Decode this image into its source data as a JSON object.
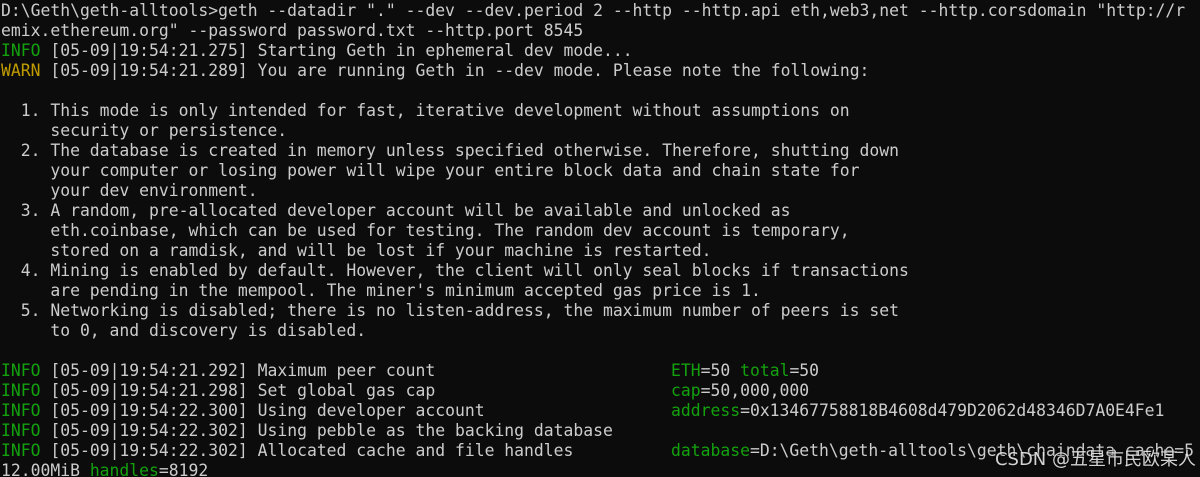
{
  "terminal": {
    "colors": {
      "background": "#0c0c0c",
      "text": "#cccccc",
      "info": "#13a10e",
      "warn": "#c19c00"
    },
    "command": {
      "line1": "D:\\Geth\\geth-alltools>geth --datadir \".\" --dev --dev.period 2 --http --http.api eth,web3,net --http.corsdomain \"http://r",
      "line2": "emix.ethereum.org\" --password password.txt --http.port 8545"
    },
    "log_head": [
      {
        "level": "INFO",
        "ts": "[05-09|19:54:21.275]",
        "msg": "Starting Geth in ephemeral dev mode..."
      },
      {
        "level": "WARN",
        "ts": "[05-09|19:54:21.289]",
        "msg": "You are running Geth in --dev mode. Please note the following:"
      }
    ],
    "notes": [
      "  1. This mode is only intended for fast, iterative development without assumptions on",
      "     security or persistence.",
      "  2. The database is created in memory unless specified otherwise. Therefore, shutting down",
      "     your computer or losing power will wipe your entire block data and chain state for",
      "     your dev environment.",
      "  3. A random, pre-allocated developer account will be available and unlocked as",
      "     eth.coinbase, which can be used for testing. The random dev account is temporary,",
      "     stored on a ramdisk, and will be lost if your machine is restarted.",
      "  4. Mining is enabled by default. However, the client will only seal blocks if transactions",
      "     are pending in the mempool. The miner's minimum accepted gas price is 1.",
      "  5. Networking is disabled; there is no listen-address, the maximum number of peers is set",
      "     to 0, and discovery is disabled."
    ],
    "log_tail": [
      {
        "level": "INFO",
        "ts": "[05-09|19:54:21.292]",
        "msg": "Maximum peer count",
        "k1": "ETH",
        "v1": "=50 ",
        "k2": "total",
        "v2": "=50"
      },
      {
        "level": "INFO",
        "ts": "[05-09|19:54:21.298]",
        "msg": "Set global gas cap",
        "k1": "cap",
        "v1": "=50,000,000",
        "k2": "",
        "v2": ""
      },
      {
        "level": "INFO",
        "ts": "[05-09|19:54:22.300]",
        "msg": "Using developer account",
        "k1": "address",
        "v1": "=0x13467758818B4608d479D2062d48346D7A0E4Fe1",
        "k2": "",
        "v2": ""
      },
      {
        "level": "INFO",
        "ts": "[05-09|19:54:22.302]",
        "msg": "Using pebble as the backing database",
        "k1": "",
        "v1": "",
        "k2": "",
        "v2": ""
      },
      {
        "level": "INFO",
        "ts": "[05-09|19:54:22.302]",
        "msg": "Allocated cache and file handles",
        "k1": "database",
        "v1": "=D:\\Geth\\geth-alltools\\geth\\chaindata cache=5",
        "k2": "",
        "v2": ""
      }
    ],
    "wrap_line": {
      "p1": "12.00MiB ",
      "key": "handles",
      "val": "=8192"
    }
  },
  "watermark": "CSDN @五星市民欧某人"
}
